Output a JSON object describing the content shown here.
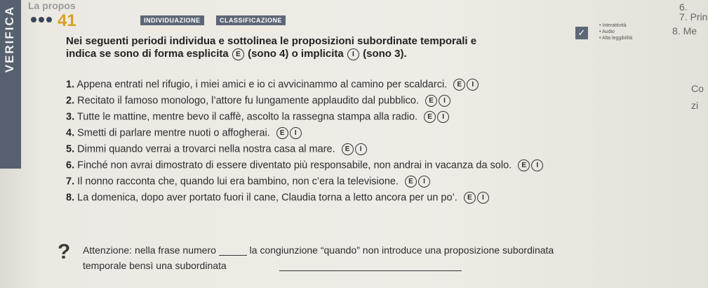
{
  "page": {
    "top_cut_text": "La propos",
    "side_tab_label": "VERIFICA",
    "exercise_number": "41",
    "tags": [
      "INDIVIDUAZIONE",
      "CLASSIFICAZIONE"
    ],
    "side_notes": [
      "• Interattività",
      "• Audio",
      "• Alta leggibilità"
    ],
    "corner_texts": [
      "6.",
      "7. Prin",
      "8. Me",
      "Co",
      "zi"
    ]
  },
  "instructions": {
    "line1": "Nei seguenti periodi individua e sottolinea le proposizioni subordinate temporali e",
    "line2_a": "indica se sono di forma esplicita",
    "line2_b": "(sono 4) o implicita",
    "line2_c": "(sono 3).",
    "option_e": "E",
    "option_i": "I"
  },
  "items": [
    {
      "num": "1.",
      "text": "Appena entrati nel rifugio, i miei amici e io ci avvicinammo al camino per scaldarci."
    },
    {
      "num": "2.",
      "text": "Recitato il famoso monologo, l’attore fu lungamente applaudito dal pubblico."
    },
    {
      "num": "3.",
      "text": "Tutte le mattine, mentre bevo il caffè, ascolto la rassegna stampa alla radio."
    },
    {
      "num": "4.",
      "text": "Smetti di parlare mentre nuoti o affogherai."
    },
    {
      "num": "5.",
      "text": "Dimmi quando verrai a trovarci nella nostra casa al mare."
    },
    {
      "num": "6.",
      "text": "Finché non avrai dimostrato di essere diventato più responsabile, non andrai in vacanza da solo."
    },
    {
      "num": "7.",
      "text": "Il nonno racconta che, quando lui era bambino, non c’era la televisione."
    },
    {
      "num": "8.",
      "text": "La domenica, dopo aver portato fuori il cane, Claudia torna a letto ancora per un po’."
    }
  ],
  "note": {
    "icon": "?",
    "line1_a": "Attenzione: nella frase numero",
    "line1_b": "la congiunzione “quando” non introduce una proposizione subordinata",
    "line2": "temporale bensì una subordinata"
  }
}
